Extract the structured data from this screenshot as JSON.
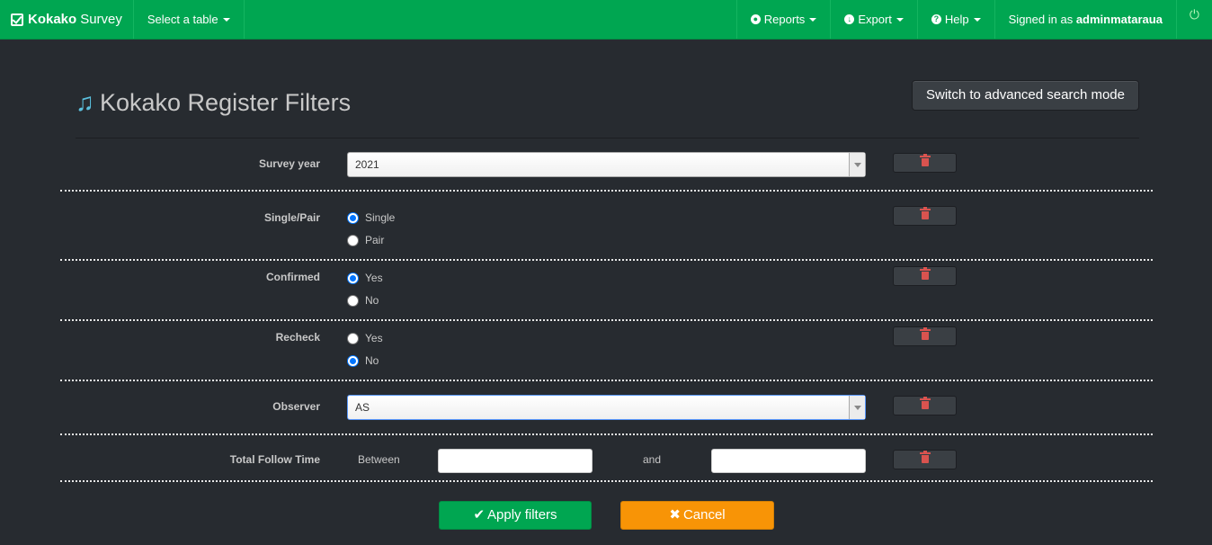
{
  "navbar": {
    "brand_bold": "Kokako",
    "brand_rest": "Survey",
    "select_table": "Select a table",
    "reports": "Reports",
    "export": "Export",
    "help": "Help",
    "signed_in_prefix": "Signed in as",
    "username": "adminmataraua",
    "colors": {
      "bar": "#00a651",
      "power_icon": "#b8f5b8"
    }
  },
  "page": {
    "title": "Kokako Register Filters",
    "advanced_button": "Switch to advanced search mode"
  },
  "filters": {
    "survey_year": {
      "label": "Survey year",
      "value": "2021"
    },
    "single_pair": {
      "label": "Single/Pair",
      "options": [
        {
          "label": "Single",
          "checked": true
        },
        {
          "label": "Pair",
          "checked": false
        }
      ]
    },
    "confirmed": {
      "label": "Confirmed",
      "options": [
        {
          "label": "Yes",
          "checked": true
        },
        {
          "label": "No",
          "checked": false
        }
      ]
    },
    "recheck": {
      "label": "Recheck",
      "options": [
        {
          "label": "Yes",
          "checked": false
        },
        {
          "label": "No",
          "checked": true
        }
      ]
    },
    "observer": {
      "label": "Observer",
      "value": "AS"
    },
    "total_follow_time": {
      "label": "Total Follow Time",
      "between_label": "Between",
      "and_label": "and",
      "from_value": "",
      "to_value": ""
    }
  },
  "actions": {
    "apply": "Apply filters",
    "cancel": "Cancel",
    "colors": {
      "apply": "#00a651",
      "cancel": "#f89406",
      "delete_icon": "#d9534f"
    }
  }
}
